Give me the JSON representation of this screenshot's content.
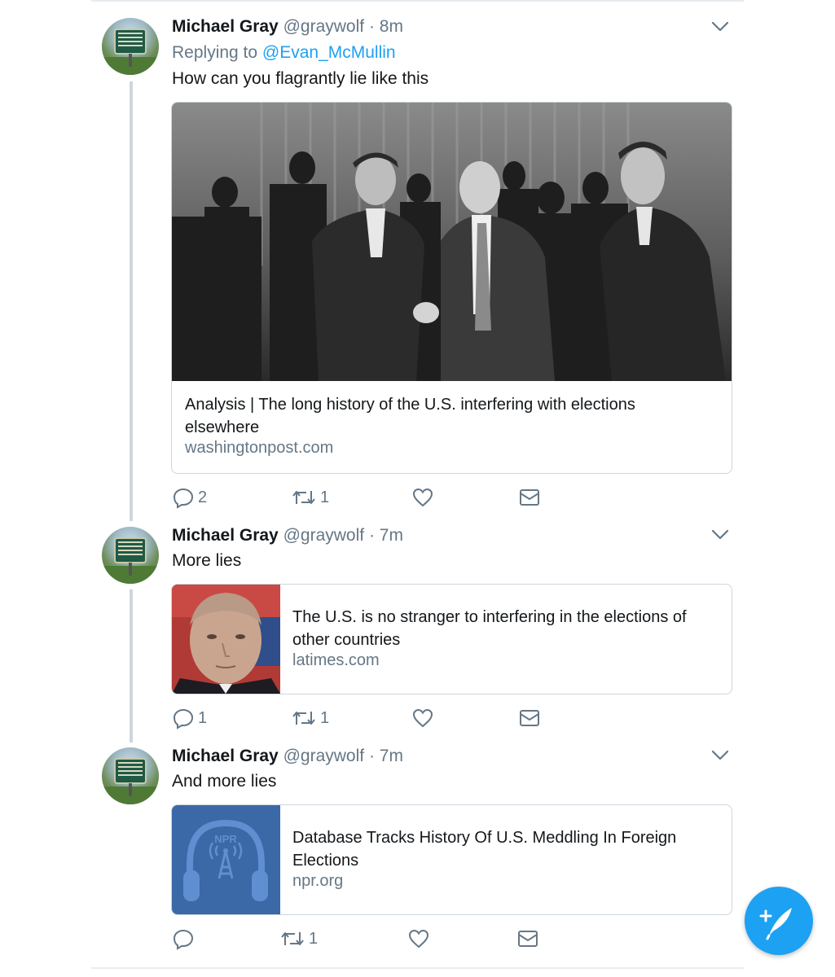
{
  "tweets": [
    {
      "name": "Michael Gray",
      "handle": "@graywolf",
      "dot": "·",
      "time": "8m",
      "replying_prefix": "Replying to",
      "replying_mention": "@Evan_McMullin",
      "text": "How can you flagrantly lie like this",
      "card": {
        "title": "Analysis | The long history of the U.S. interfering with elections elsewhere",
        "domain": "washingtonpost.com"
      },
      "actions": {
        "replies": "2",
        "retweets": "1",
        "likes": ""
      }
    },
    {
      "name": "Michael Gray",
      "handle": "@graywolf",
      "dot": "·",
      "time": "7m",
      "text": "More lies",
      "card": {
        "title": "The U.S. is no stranger to interfering in the elections of other countries",
        "domain": "latimes.com"
      },
      "actions": {
        "replies": "1",
        "retweets": "1",
        "likes": ""
      }
    },
    {
      "name": "Michael Gray",
      "handle": "@graywolf",
      "dot": "·",
      "time": "7m",
      "text": "And more lies",
      "card": {
        "title": "Database Tracks History Of U.S. Meddling In Foreign Elections",
        "domain": "npr.org",
        "thumb_text": "NPR"
      },
      "actions": {
        "replies": "",
        "retweets": "1",
        "likes": ""
      }
    }
  ],
  "colors": {
    "accent": "#1da1f2",
    "secondary_text": "#657786",
    "border": "#ccd6dd",
    "npr_blue": "#3b68a6"
  },
  "icons": {
    "reply": "reply-icon",
    "retweet": "retweet-icon",
    "like": "heart-icon",
    "dm": "envelope-icon",
    "caret": "chevron-down-icon",
    "compose": "compose-quill-icon"
  }
}
